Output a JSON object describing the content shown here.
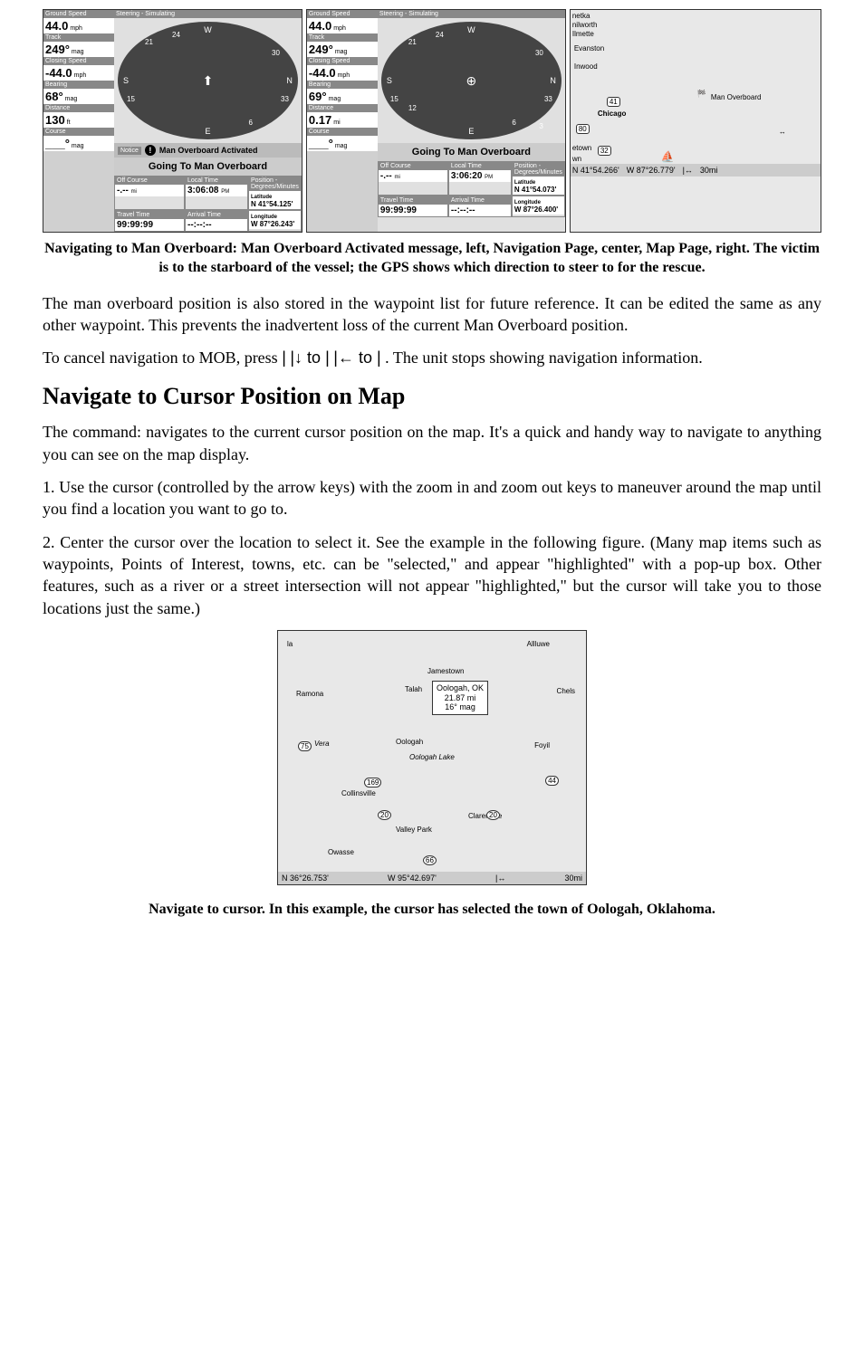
{
  "gps_left": {
    "header": "Steering - Simulating",
    "fields": {
      "ground_speed_label": "Ground Speed",
      "ground_speed": "44.0",
      "ground_speed_unit": "mph",
      "track_label": "Track",
      "track": "249°",
      "track_unit": "mag",
      "closing_speed_label": "Closing Speed",
      "closing_speed": "-44.0",
      "closing_speed_unit": "mph",
      "bearing_label": "Bearing",
      "bearing": "68°",
      "bearing_unit": "mag",
      "distance_label": "Distance",
      "distance": "130",
      "distance_unit": "ft",
      "course_label": "Course",
      "course": "___°",
      "course_unit": "mag"
    },
    "notice_label": "Notice",
    "notice": "Man Overboard Activated",
    "going": "Going To Man Overboard",
    "compass": {
      "n": "N",
      "s": "S",
      "e": "E",
      "w": "W",
      "tick1": "15",
      "tick2": "21",
      "tick3": "24",
      "tick4": "30",
      "tick5": "33",
      "tick6": "6"
    },
    "bottom": {
      "off_course_label": "Off Course",
      "off_course": "-.--",
      "off_course_unit": "mi",
      "travel_time_label": "Travel Time",
      "travel_time": "99:99:99",
      "local_time_label": "Local Time",
      "local_time": "3:06:08",
      "local_time_ampm": "PM",
      "arrival_time_label": "Arrival Time",
      "arrival_time": "--:--:--",
      "position_label": "Position - Degrees/Minutes",
      "lat_label": "Latitude",
      "lat": "N   41°54.125'",
      "lon_label": "Longitude",
      "lon": "W   87°26.243'"
    }
  },
  "gps_center": {
    "header": "Steering - Simulating",
    "fields": {
      "ground_speed_label": "Ground Speed",
      "ground_speed": "44.0",
      "ground_speed_unit": "mph",
      "track_label": "Track",
      "track": "249°",
      "track_unit": "mag",
      "closing_speed_label": "Closing Speed",
      "closing_speed": "-44.0",
      "closing_speed_unit": "mph",
      "bearing_label": "Bearing",
      "bearing": "69°",
      "bearing_unit": "mag",
      "distance_label": "Distance",
      "distance": "0.17",
      "distance_unit": "mi",
      "course_label": "Course",
      "course": "___°",
      "course_unit": "mag"
    },
    "going": "Going To Man Overboard",
    "compass": {
      "n": "N",
      "s": "S",
      "e": "E",
      "w": "W",
      "tick1": "15",
      "tick2": "21",
      "tick3": "24",
      "tick4": "30",
      "tick5": "33",
      "tick6": "6",
      "tick7": "12",
      "tick8": "3"
    },
    "bottom": {
      "off_course_label": "Off Course",
      "off_course": "-.--",
      "off_course_unit": "mi",
      "travel_time_label": "Travel Time",
      "travel_time": "99:99:99",
      "local_time_label": "Local Time",
      "local_time": "3:06:20",
      "local_time_ampm": "PM",
      "arrival_time_label": "Arrival Time",
      "arrival_time": "--:--:--",
      "position_label": "Position - Degrees/Minutes",
      "lat_label": "Latitude",
      "lat": "N   41°54.073'",
      "lon_label": "Longitude",
      "lon": "W   87°26.400'"
    }
  },
  "gps_right": {
    "places": {
      "p1": "netka",
      "p2": "nilworth",
      "p3": "Ilmette",
      "p4": "Evanston",
      "p5": "Inwood",
      "p6": "Chicago",
      "p7": "etown",
      "p8": "wn"
    },
    "mob_marker": "Man Overboard",
    "route41": "41",
    "route32": "32",
    "route80": "80",
    "coords": {
      "lat": "N   41°54.266'",
      "lon": "W   87°26.779'",
      "scale": "30mi"
    }
  },
  "caption1": "Navigating to Man Overboard: Man Overboard Activated message, left, Navigation Page, center, Map Page, right. The victim is to the starboard of the vessel; the GPS shows which direction to steer to for the rescue.",
  "para1": "The man overboard position is also stored in the waypoint list for future reference. It can be edited the same as any other waypoint. This prevents the inadvertent loss of the current Man Overboard position.",
  "para2a": "To cancel navigation to MOB, press ",
  "para2b": "|",
  "para2c": "|↓ to ",
  "para2d": "|",
  "para2e": "|← to ",
  "para2f": "|",
  "para2g": ". The unit stops showing navigation information.",
  "heading": "Navigate to Cursor Position on Map",
  "para3a": "The ",
  "para3b": " command: navigates to the current cursor position on the map. It's a quick and handy way to navigate to anything you can see on the map display.",
  "para4": "1. Use the cursor (controlled by the arrow keys) with the zoom in and zoom out keys to maneuver around the map until you find a location you want to go to.",
  "para5": "2. Center the cursor over the location to select it. See the example in the following figure. (Many map items such as waypoints, Points of Interest, towns, etc. can be \"selected,\" and appear \"highlighted\" with a pop-up box. Other features, such as a river or a street intersection will not appear \"highlighted,\" but the cursor will take you to those locations just the same.)",
  "mapfig": {
    "popup": {
      "line1": "Oologah, OK",
      "line2": "21.87 mi",
      "line3": "16° mag"
    },
    "labels": {
      "l1": "la",
      "l2": "Allluwe",
      "l3": "Jamestown",
      "l4": "Ramona",
      "l5": "Talah",
      "l6": "Chels",
      "l7": "Vera",
      "l8": "Oologah",
      "l9": "Oologah Lake",
      "l10": "Foyil",
      "l11": "Collinsville",
      "l12": "Valley Park",
      "l13": "Owasse",
      "l14": "Claremore"
    },
    "routes": {
      "r75": "75",
      "r169": "169",
      "r20a": "20",
      "r20b": "20",
      "r66": "66",
      "r44": "44"
    },
    "coords": {
      "lat": "N   36°26.753'",
      "lon": "W   95°42.697'",
      "scale": "30mi"
    }
  },
  "caption2": "Navigate to cursor. In this example, the cursor has selected the town of Oologah, Oklahoma."
}
